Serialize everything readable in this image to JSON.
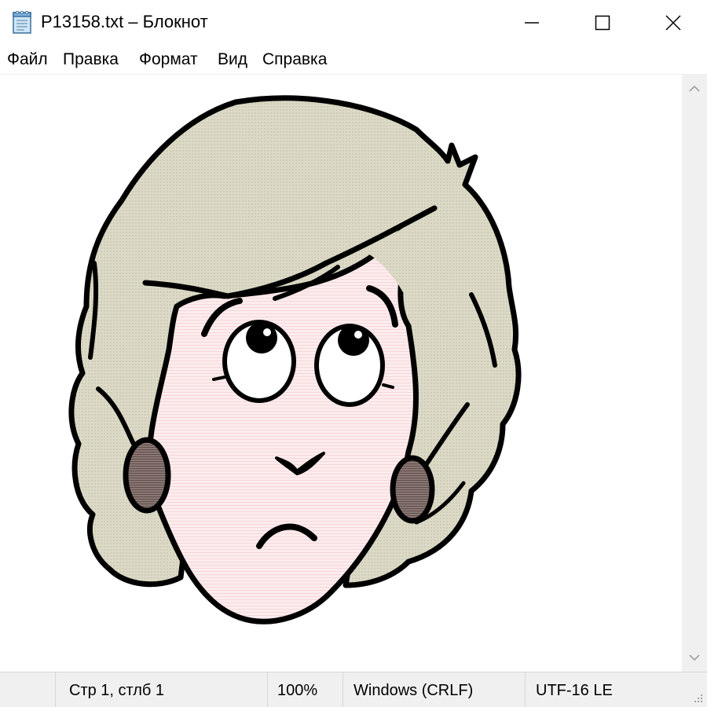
{
  "window": {
    "title": "P13158.txt – Блокнот",
    "icon": "notepad-icon",
    "controls": [
      "minimize-icon",
      "maximize-icon",
      "close-icon"
    ]
  },
  "menu": {
    "file": "Файл",
    "edit": "Правка",
    "format": "Формат",
    "view": "Вид",
    "help": "Справка"
  },
  "editor": {
    "content_kind": "cartoon-woman-face-illustration",
    "colors": {
      "hair": "#d9d8c3",
      "skin": "#fbe9ea",
      "earring": "#7d6a66",
      "outline": "#000000",
      "eye_white": "#ffffff"
    }
  },
  "scrollbar": {
    "up": "chevron-up-icon",
    "down": "chevron-down-icon"
  },
  "status": {
    "position": "Стр 1, стлб 1",
    "zoom": "100%",
    "line_endings": "Windows (CRLF)",
    "encoding": "UTF-16 LE"
  }
}
